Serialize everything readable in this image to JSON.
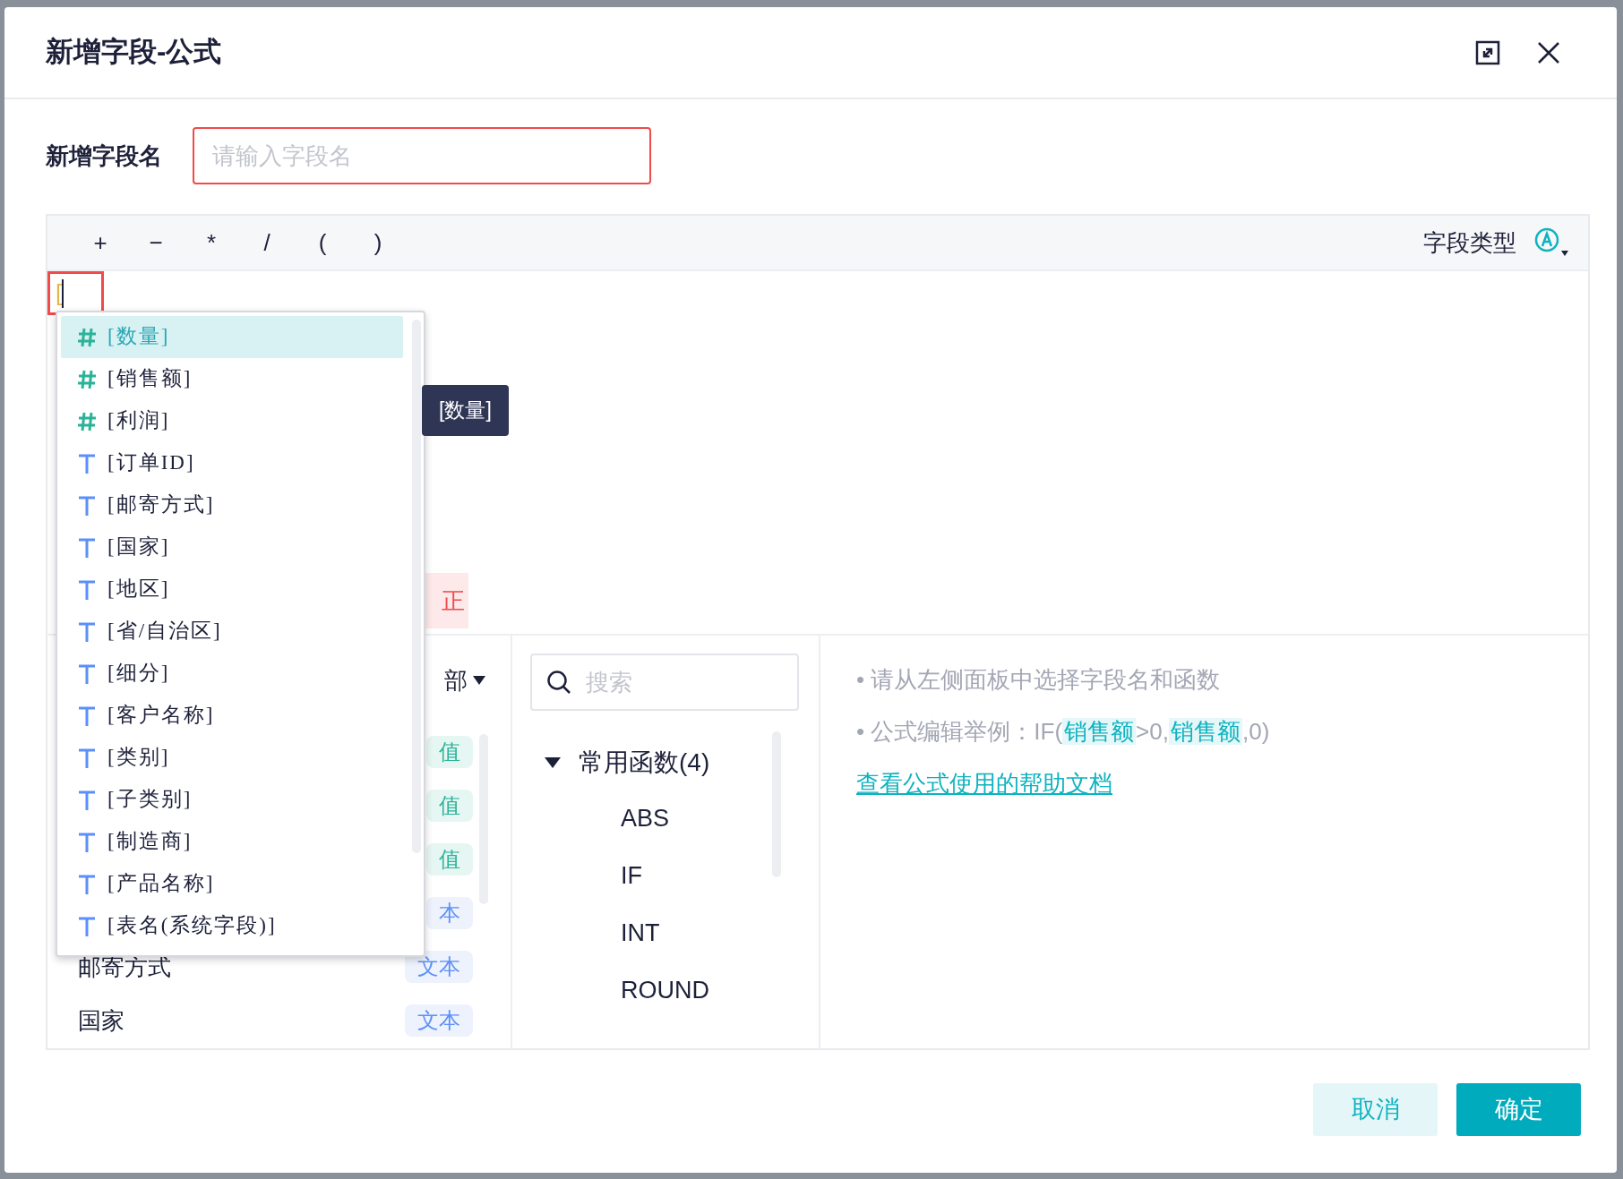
{
  "dialog": {
    "title": "新增字段-公式"
  },
  "field_name": {
    "label": "新增字段名",
    "placeholder": "请输入字段名"
  },
  "operators": [
    "+",
    "−",
    "*",
    "/",
    "(",
    ")"
  ],
  "field_type": {
    "label": "字段类型"
  },
  "editor": {
    "text": "["
  },
  "fix_button": {
    "label": "正"
  },
  "tooltip": {
    "text": "[数量]"
  },
  "suggestions": [
    {
      "kind": "number",
      "label": "[数量]",
      "selected": true
    },
    {
      "kind": "number",
      "label": "[销售额]",
      "selected": false
    },
    {
      "kind": "number",
      "label": "[利润]",
      "selected": false
    },
    {
      "kind": "text",
      "label": "[订单ID]",
      "selected": false
    },
    {
      "kind": "text",
      "label": "[邮寄方式]",
      "selected": false
    },
    {
      "kind": "text",
      "label": "[国家]",
      "selected": false
    },
    {
      "kind": "text",
      "label": "[地区]",
      "selected": false
    },
    {
      "kind": "text",
      "label": "[省/自治区]",
      "selected": false
    },
    {
      "kind": "text",
      "label": "[细分]",
      "selected": false
    },
    {
      "kind": "text",
      "label": "[客户名称]",
      "selected": false
    },
    {
      "kind": "text",
      "label": "[类别]",
      "selected": false
    },
    {
      "kind": "text",
      "label": "[子类别]",
      "selected": false
    },
    {
      "kind": "text",
      "label": "[制造商]",
      "selected": false
    },
    {
      "kind": "text",
      "label": "[产品名称]",
      "selected": false
    },
    {
      "kind": "text",
      "label": "[表名(系统字段)]",
      "selected": false
    }
  ],
  "field_panel": {
    "filter": "部",
    "rows": [
      {
        "kind": "number",
        "tag": "值"
      },
      {
        "kind": "number",
        "tag": "值"
      },
      {
        "kind": "number",
        "tag": "值"
      },
      {
        "kind": "text",
        "tag": "本"
      },
      {
        "kind": "text",
        "name": "邮寄方式",
        "tag": "文本"
      },
      {
        "kind": "text",
        "name": "国家",
        "tag": "文本"
      }
    ]
  },
  "function_panel": {
    "search_placeholder": "搜索",
    "group": {
      "label": "常用函数(4)",
      "expanded": true,
      "items": [
        "ABS",
        "IF",
        "INT",
        "ROUND"
      ]
    }
  },
  "help": {
    "lines": [
      "• 请从左侧面板中选择字段名和函数",
      "• 公式编辑举例：IF(**销售额**>0,**销售额**,0)"
    ],
    "link": "查看公式使用的帮助文档"
  },
  "buttons": {
    "cancel": "取消",
    "confirm": "确定"
  }
}
